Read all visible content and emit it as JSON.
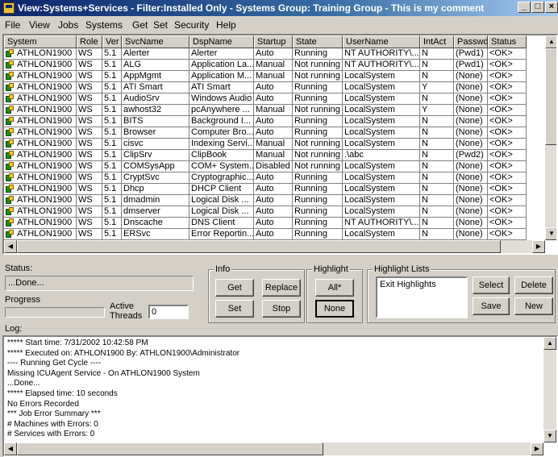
{
  "window": {
    "title": "View:Systems+Services - Filter:Installed Only - Systems Group: Training Group - This is my comment"
  },
  "menu": [
    "File",
    "View",
    "Jobs",
    "Systems",
    "Get",
    "Set",
    "Security",
    "Help"
  ],
  "grid": {
    "columns": [
      "System",
      "Role",
      "Ver",
      "SvcName",
      "DspName",
      "Startup",
      "State",
      "UserName",
      "IntAct",
      "Passwd",
      "Status"
    ],
    "rows": [
      [
        "ATHLON1900",
        "WS",
        "5.1",
        "Alerter",
        "Alerter",
        "Auto",
        "Running",
        "NT AUTHORITY\\...",
        "N",
        "(Pwd1)",
        "<OK>"
      ],
      [
        "ATHLON1900",
        "WS",
        "5.1",
        "ALG",
        "Application La...",
        "Manual",
        "Not running",
        "NT AUTHORITY\\...",
        "N",
        "(Pwd1)",
        "<OK>"
      ],
      [
        "ATHLON1900",
        "WS",
        "5.1",
        "AppMgmt",
        "Application M...",
        "Manual",
        "Not running",
        "LocalSystem",
        "N",
        "(None)",
        "<OK>"
      ],
      [
        "ATHLON1900",
        "WS",
        "5.1",
        "ATI Smart",
        "ATI Smart",
        "Auto",
        "Running",
        "LocalSystem",
        "Y",
        "(None)",
        "<OK>"
      ],
      [
        "ATHLON1900",
        "WS",
        "5.1",
        "AudioSrv",
        "Windows Audio",
        "Auto",
        "Running",
        "LocalSystem",
        "N",
        "(None)",
        "<OK>"
      ],
      [
        "ATHLON1900",
        "WS",
        "5.1",
        "awhost32",
        "pcAnywhere ...",
        "Manual",
        "Not running",
        "LocalSystem",
        "Y",
        "(None)",
        "<OK>"
      ],
      [
        "ATHLON1900",
        "WS",
        "5.1",
        "BITS",
        "Background I...",
        "Auto",
        "Running",
        "LocalSystem",
        "N",
        "(None)",
        "<OK>"
      ],
      [
        "ATHLON1900",
        "WS",
        "5.1",
        "Browser",
        "Computer Bro...",
        "Auto",
        "Running",
        "LocalSystem",
        "N",
        "(None)",
        "<OK>"
      ],
      [
        "ATHLON1900",
        "WS",
        "5.1",
        "cisvc",
        "Indexing Servi...",
        "Manual",
        "Not running",
        "LocalSystem",
        "N",
        "(None)",
        "<OK>"
      ],
      [
        "ATHLON1900",
        "WS",
        "5.1",
        "ClipSrv",
        "ClipBook",
        "Manual",
        "Not running",
        ".\\abc",
        "N",
        "(Pwd2)",
        "<OK>"
      ],
      [
        "ATHLON1900",
        "WS",
        "5.1",
        "COMSysApp",
        "COM+ System...",
        "Disabled",
        "Not running",
        "LocalSystem",
        "N",
        "(None)",
        "<OK>"
      ],
      [
        "ATHLON1900",
        "WS",
        "5.1",
        "CryptSvc",
        "Cryptographic...",
        "Auto",
        "Running",
        "LocalSystem",
        "N",
        "(None)",
        "<OK>"
      ],
      [
        "ATHLON1900",
        "WS",
        "5.1",
        "Dhcp",
        "DHCP Client",
        "Auto",
        "Running",
        "LocalSystem",
        "N",
        "(None)",
        "<OK>"
      ],
      [
        "ATHLON1900",
        "WS",
        "5.1",
        "dmadmin",
        "Logical Disk ...",
        "Auto",
        "Running",
        "LocalSystem",
        "N",
        "(None)",
        "<OK>"
      ],
      [
        "ATHLON1900",
        "WS",
        "5.1",
        "dmserver",
        "Logical Disk ...",
        "Auto",
        "Running",
        "LocalSystem",
        "N",
        "(None)",
        "<OK>"
      ],
      [
        "ATHLON1900",
        "WS",
        "5.1",
        "Dnscache",
        "DNS Client",
        "Auto",
        "Running",
        "NT AUTHORITY\\...",
        "N",
        "(None)",
        "<OK>"
      ],
      [
        "ATHLON1900",
        "WS",
        "5.1",
        "ERSvc",
        "Error Reportin...",
        "Auto",
        "Running",
        "LocalSystem",
        "N",
        "(None)",
        "<OK>"
      ]
    ]
  },
  "status": {
    "label": "Status:",
    "value": "...Done..."
  },
  "progress": {
    "label": "Progress",
    "fraction": 0
  },
  "threads": {
    "label": "Active Threads",
    "value": "0"
  },
  "info": {
    "title": "Info",
    "get": "Get",
    "replace": "Replace",
    "set": "Set",
    "stop": "Stop"
  },
  "highlight": {
    "title": "Highlight",
    "all": "All*",
    "none": "None"
  },
  "highlight_lists": {
    "title": "Highlight Lists",
    "items": [
      "Exit Highlights"
    ],
    "select": "Select",
    "delete": "Delete",
    "save": "Save",
    "new": "New"
  },
  "log": {
    "label": "Log:",
    "lines": [
      "***** Start time: 7/31/2002 10:42:58 PM",
      "***** Executed on: ATHLON1900  By: ATHLON1900\\Administrator",
      "---- Running Get Cycle ----",
      "Missing ICUAgent Service - On ATHLON1900 System",
      "...Done...",
      "***** Elapsed time: 10 seconds",
      "No Errors Recorded",
      "*** Job Error Summary ***",
      "# Machines with Errors: 0",
      "# Services with Errors: 0"
    ]
  },
  "icons": {
    "app": "app-icon",
    "service_row": "service-icon"
  }
}
